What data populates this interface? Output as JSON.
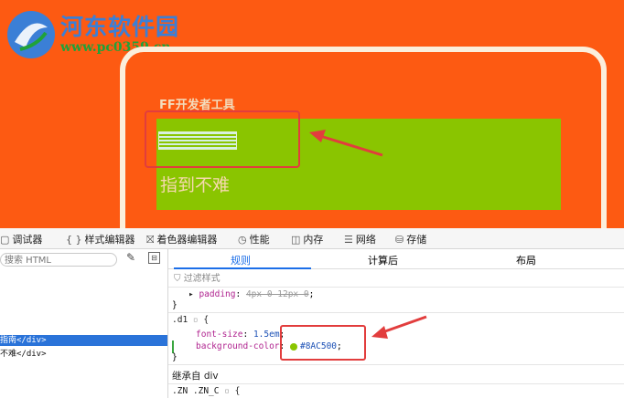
{
  "watermark": {
    "site_name": "河东软件园",
    "url": "www.pc0359.cn"
  },
  "preview": {
    "title": "FF开发者工具",
    "box_text": "指到不难"
  },
  "devtools_tabs": [
    {
      "icon": "debugger-icon",
      "glyph": "▢",
      "label": "调试器"
    },
    {
      "icon": "braces-icon",
      "glyph": "{ }",
      "label": "样式编辑器"
    },
    {
      "icon": "shader-icon",
      "glyph": "⛝",
      "label": "着色器编辑器"
    },
    {
      "icon": "performance-icon",
      "glyph": "◷",
      "label": "性能"
    },
    {
      "icon": "memory-icon",
      "glyph": "◫",
      "label": "内存"
    },
    {
      "icon": "network-icon",
      "glyph": "☰",
      "label": "网络"
    },
    {
      "icon": "storage-icon",
      "glyph": "⛁",
      "label": "存储"
    }
  ],
  "inspector": {
    "search_placeholder": "搜索 HTML",
    "selected_node": "指南</div>",
    "next_node": "不难</div>"
  },
  "rules_panel": {
    "tabs": [
      "规则",
      "计算后",
      "布局"
    ],
    "active_tab": "规则",
    "filter_placeholder": "过滤样式",
    "prev_rule": {
      "property": "padding",
      "value": "4px 0 12px 0",
      "close": "}"
    },
    "rule": {
      "selector": ".d1",
      "open": "{",
      "declarations": [
        {
          "property": "font-size",
          "value": "1.5em"
        },
        {
          "property": "background-color",
          "value": "#8AC500"
        }
      ],
      "close": "}"
    },
    "inherited_header": "继承自 div",
    "next_selector": ".ZN .ZN_C",
    "next_open": "{"
  },
  "colors": {
    "preview_bg": "#fd5a12",
    "highlight_green": "#8ac500",
    "annotation_red": "#e23d3d",
    "accent_blue": "#1b6ee8"
  }
}
